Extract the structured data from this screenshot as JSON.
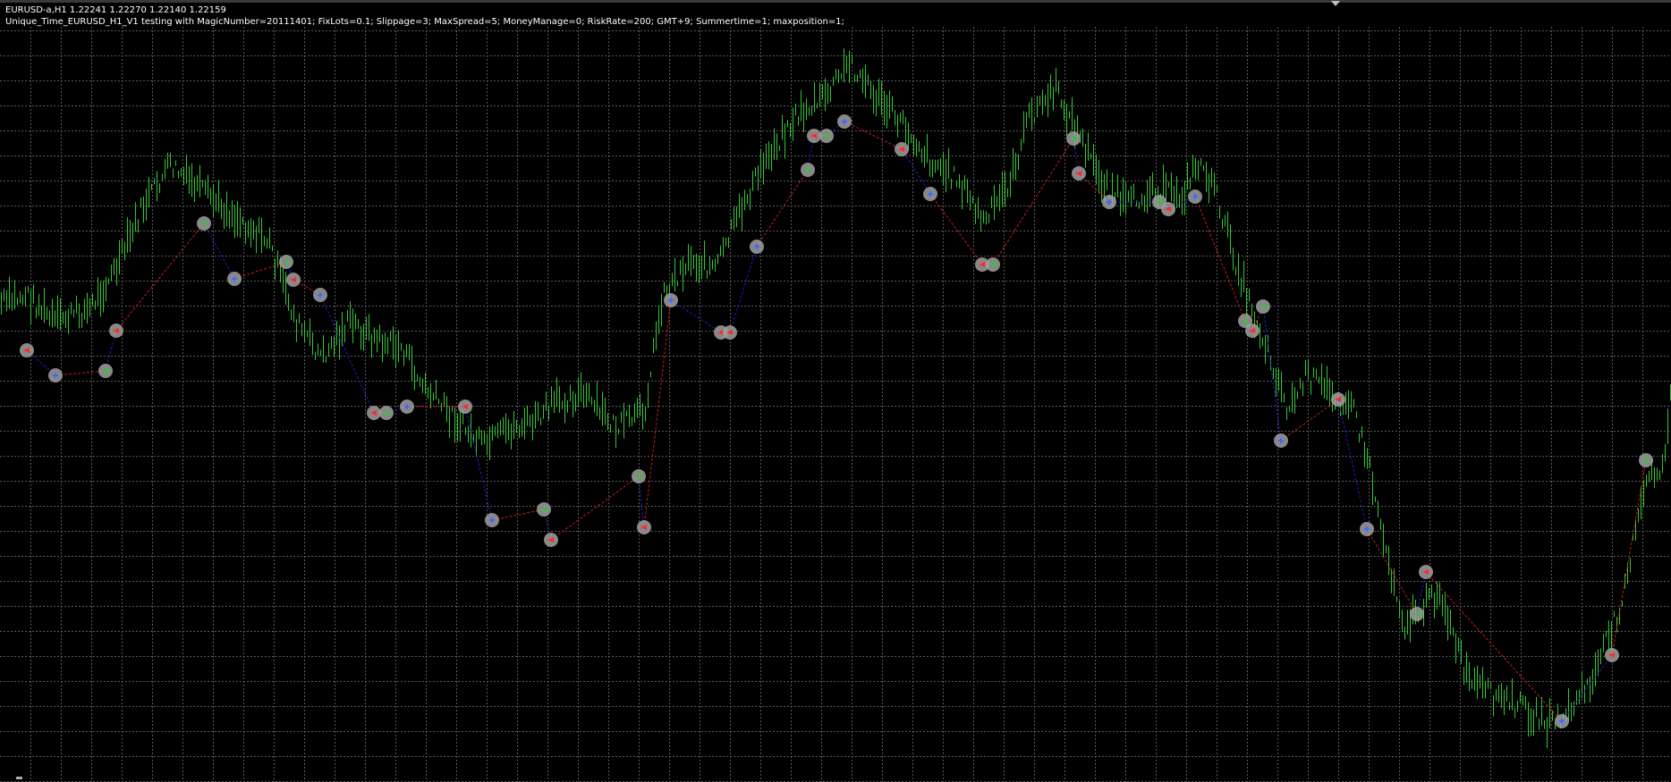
{
  "chart": {
    "symbol_line": "EURUSD-a,H1  1.22241 1.22270 1.22140 1.22159",
    "ea_line": "Unique_Time_EURUSD_H1_V1 testing with MagicNumber=20111401; FixLots=0.1; Slippage=3; MaxSpread=5; MoneyManage=0; RiskRate=200; GMT+9; Summertime=1; maxposition=1;"
  },
  "colors": {
    "background": "#000000",
    "grid": "#5a5a5a",
    "candles": "#32c832",
    "buy_line": "#1e1ec8",
    "sell_line": "#c81e1e",
    "marker_ring": "#a0a0a0",
    "buy_arrow": "#3c6cff",
    "sell_arrow": "#ff2a2a"
  }
}
